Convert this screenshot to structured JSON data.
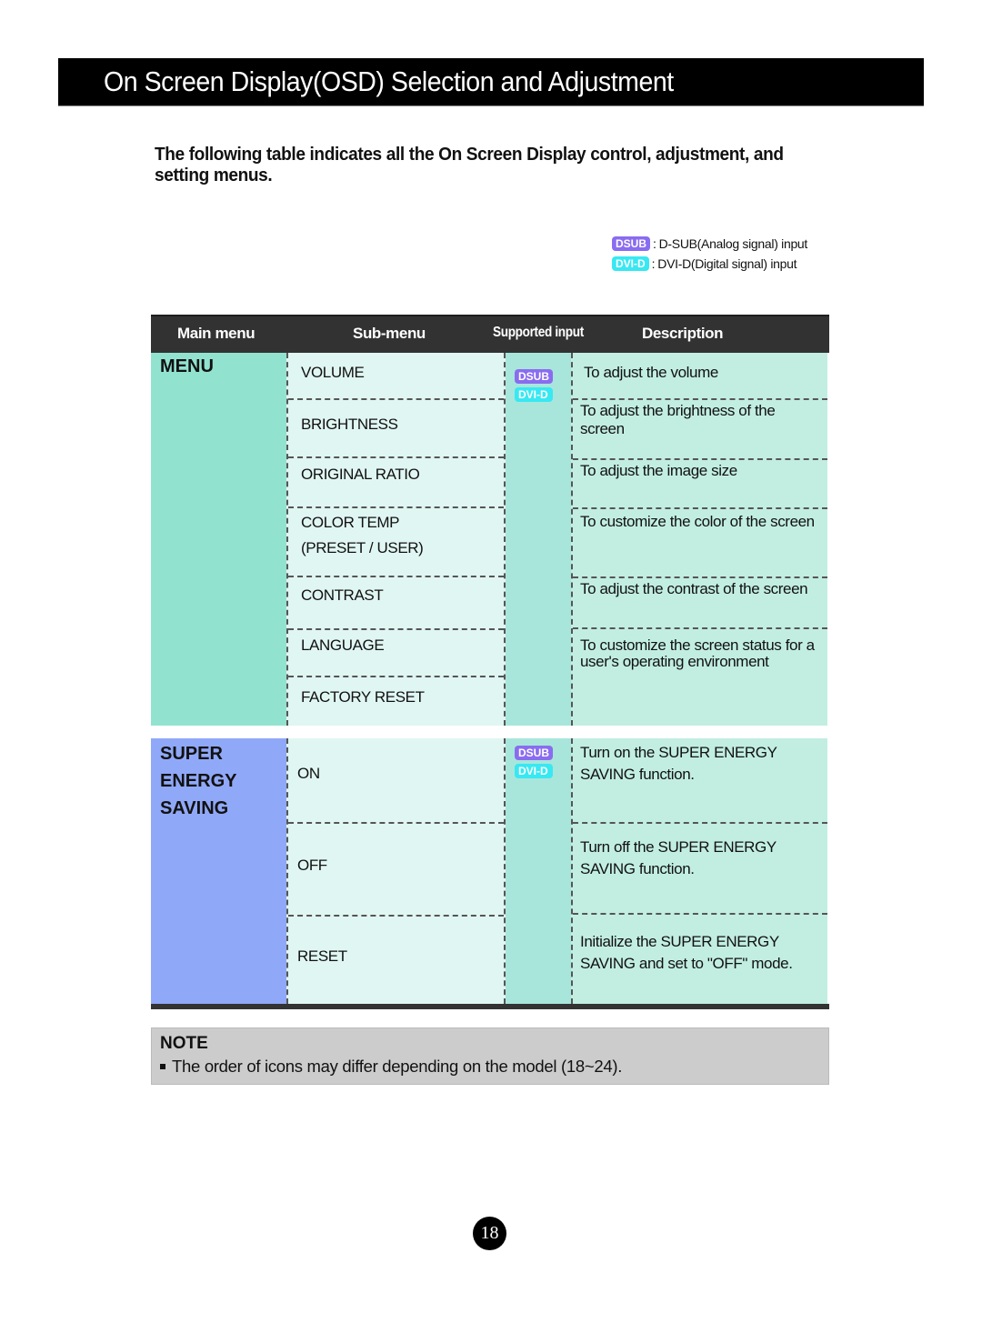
{
  "header": {
    "title": "On Screen Display(OSD) Selection and Adjustment"
  },
  "intro": "The following table indicates all the On Screen Display control, adjustment, and setting menus.",
  "legend": [
    {
      "badge": "DSUB",
      "text": "D-SUB(Analog signal) input"
    },
    {
      "badge": "DVI-D",
      "text": "DVI-D(Digital signal) input"
    }
  ],
  "colors": {
    "dsub_badge": "#8a6cf0",
    "dvid_badge": "#38e8f2",
    "menu_section": "#92e2d0",
    "energy_section": "#90a8f8",
    "header_bg": "#323232"
  },
  "table": {
    "headers": [
      "Main menu",
      "Sub-menu",
      "Supported input",
      "Description"
    ],
    "sections": [
      {
        "main_menu": "MENU",
        "inputs": [
          "DSUB",
          "DVI-D"
        ],
        "submenus": [
          {
            "label": "VOLUME"
          },
          {
            "label": "BRIGHTNESS"
          },
          {
            "label": "ORIGINAL RATIO"
          },
          {
            "label": "COLOR TEMP (PRESET / USER)",
            "line1": "COLOR TEMP",
            "line2": "(PRESET / USER)"
          },
          {
            "label": "CONTRAST"
          },
          {
            "label": "LANGUAGE"
          },
          {
            "label": "FACTORY RESET"
          }
        ],
        "descriptions": [
          "To adjust the volume",
          "To adjust the brightness of the screen",
          "To adjust the image size",
          "To customize the color of the screen",
          "To adjust the contrast of the screen",
          "To customize the screen status for a user's operating environment"
        ]
      },
      {
        "main_menu": "SUPER ENERGY SAVING",
        "main_menu_lines": [
          "SUPER",
          "ENERGY",
          "SAVING"
        ],
        "inputs": [
          "DSUB",
          "DVI-D"
        ],
        "submenus": [
          {
            "label": "ON"
          },
          {
            "label": "OFF"
          },
          {
            "label": "RESET"
          }
        ],
        "descriptions": [
          "Turn on the SUPER ENERGY SAVING function.",
          "Turn off the SUPER ENERGY SAVING function.",
          "Initialize the SUPER ENERGY SAVING and set to \"OFF\" mode."
        ]
      }
    ]
  },
  "note": {
    "title": "NOTE",
    "text": "The order of icons may differ depending on the model (18~24)."
  },
  "page_number": "18"
}
